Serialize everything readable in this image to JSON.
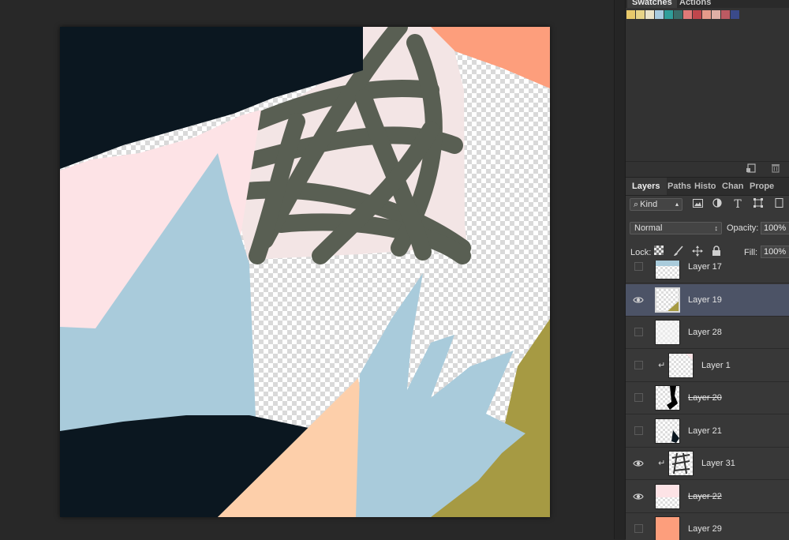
{
  "swatches_panel": {
    "tabs": [
      {
        "label": "Swatches",
        "active": true
      },
      {
        "label": "Actions",
        "active": false
      }
    ],
    "colors": [
      "#e8c96a",
      "#e8d487",
      "#eae3c9",
      "#a8cbe0",
      "#2f9e9a",
      "#3a6e6a",
      "#e07a78",
      "#c0464c",
      "#e69a8a",
      "#e0b0a6",
      "#bc5a62",
      "#3a4a8a"
    ],
    "footer_icons": [
      "new-swatch-icon",
      "trash-icon"
    ]
  },
  "layers_panel": {
    "tabs": [
      {
        "label": "Layers",
        "active": true
      },
      {
        "label": "Paths",
        "active": false
      },
      {
        "label": "Histo",
        "active": false
      },
      {
        "label": "Chan",
        "active": false
      },
      {
        "label": "Prope",
        "active": false
      }
    ],
    "filter": {
      "kind_label": "Kind"
    },
    "blend_mode": "Normal",
    "opacity_label": "Opacity:",
    "opacity_value": "100%",
    "lock_label": "Lock:",
    "fill_label": "Fill:",
    "fill_value": "100%",
    "layers": [
      {
        "name": "Layer 17",
        "visible": false,
        "selected": false,
        "clipped": false,
        "struck": false
      },
      {
        "name": "Layer 19",
        "visible": true,
        "selected": true,
        "clipped": false,
        "struck": false
      },
      {
        "name": "Layer 28",
        "visible": false,
        "selected": false,
        "clipped": false,
        "struck": false
      },
      {
        "name": "Layer 1",
        "visible": false,
        "selected": false,
        "clipped": true,
        "struck": false
      },
      {
        "name": "Layer 20",
        "visible": false,
        "selected": false,
        "clipped": false,
        "struck": true
      },
      {
        "name": "Layer 21",
        "visible": false,
        "selected": false,
        "clipped": false,
        "struck": false
      },
      {
        "name": "Layer 31",
        "visible": true,
        "selected": false,
        "clipped": true,
        "struck": false
      },
      {
        "name": "Layer 22",
        "visible": true,
        "selected": false,
        "clipped": false,
        "struck": true
      },
      {
        "name": "Layer 29",
        "visible": false,
        "selected": false,
        "clipped": false,
        "struck": false
      }
    ]
  },
  "canvas": {
    "colors": {
      "navy": "#0b1720",
      "pink": "#fde3e6",
      "blush": "#f3e5e5",
      "blue": "#a9cbdb",
      "peach": "#fdcfaa",
      "coral": "#fd9e7c",
      "olive": "#a69a43",
      "gray_green": "#595f53"
    }
  }
}
